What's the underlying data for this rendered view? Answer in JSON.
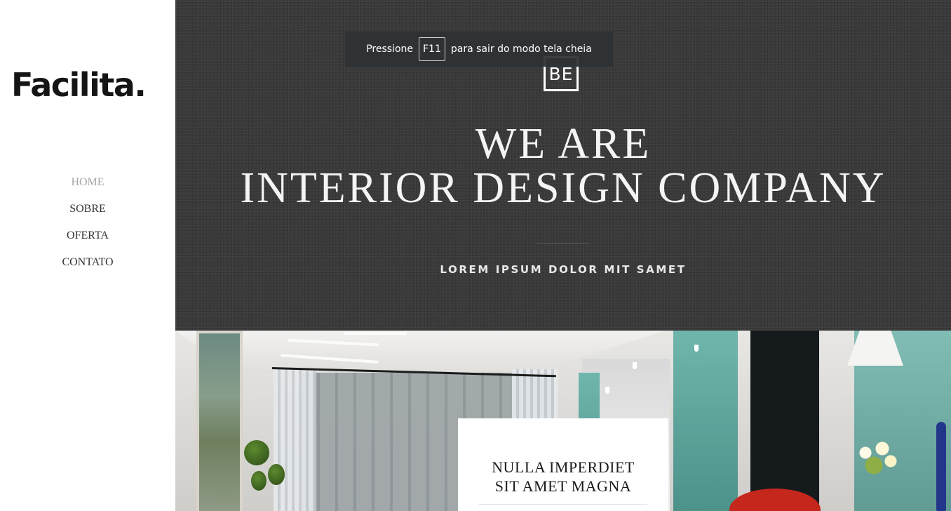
{
  "brand": {
    "logo_text": "Facilita."
  },
  "nav": {
    "items": [
      {
        "label": "HOME",
        "active": true
      },
      {
        "label": "SOBRE",
        "active": false
      },
      {
        "label": "OFERTA",
        "active": false
      },
      {
        "label": "CONTATO",
        "active": false
      }
    ]
  },
  "hero": {
    "badge": "BE",
    "title_line1": "WE ARE",
    "title_line2": "INTERIOR DESIGN COMPANY",
    "subtitle": "LOREM IPSUM DOLOR MIT SAMET"
  },
  "fullscreen_toast": {
    "prefix": "Pressione",
    "key": "F11",
    "suffix": "para sair do modo tela cheia"
  },
  "card": {
    "title_line1": "NULLA IMPERDIET",
    "title_line2": "SIT AMET MAGNA"
  },
  "colors": {
    "hero_bg": "#3a3a3a",
    "nav_active": "#a6a6a6",
    "nav_text": "#333333",
    "text_light": "#f4f4f4"
  }
}
